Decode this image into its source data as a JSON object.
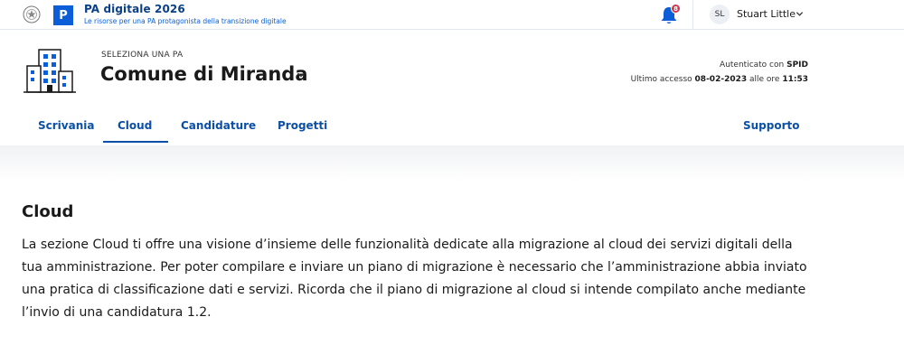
{
  "topbar": {
    "brand_letter": "P",
    "brand_title": "PA digitale 2026",
    "brand_subtitle": "Le risorse per una PA protagonista della transizione digitale",
    "notifications_count": "8",
    "user_initials": "SL",
    "user_name": "Stuart Little"
  },
  "header": {
    "select_label": "SELEZIONA UNA PA",
    "pa_name": "Comune di Miranda",
    "auth_prefix": "Autenticato con",
    "auth_method": "SPID",
    "access_prefix": "Ultimo accesso",
    "access_date": "08-02-2023",
    "access_mid": "alle ore",
    "access_time": "11:53"
  },
  "nav": {
    "items": [
      {
        "label": "Scrivania"
      },
      {
        "label": "Cloud"
      },
      {
        "label": "Candidature"
      },
      {
        "label": "Progetti"
      }
    ],
    "support": "Supporto",
    "active": "Cloud"
  },
  "content": {
    "title": "Cloud",
    "paragraph": "La sezione Cloud ti offre una visione d’insieme delle funzionalità dedicate alla migrazione al cloud dei servizi digitali della tua amministrazione. Per poter compilare e inviare un piano di migrazione è necessario che l’amministrazione abbia inviato una pratica di classificazione dati e servizi. Ricorda che il piano di migrazione al cloud si intende compilato anche mediante l’invio di una candidatura 1.2."
  },
  "colors": {
    "primary": "#0b4fa8",
    "brand_box": "#0b5ed7",
    "badge": "#d1344c"
  },
  "icons": [
    "emblem-icon",
    "bell-icon",
    "chevron-down-icon",
    "building-illustration-icon"
  ]
}
